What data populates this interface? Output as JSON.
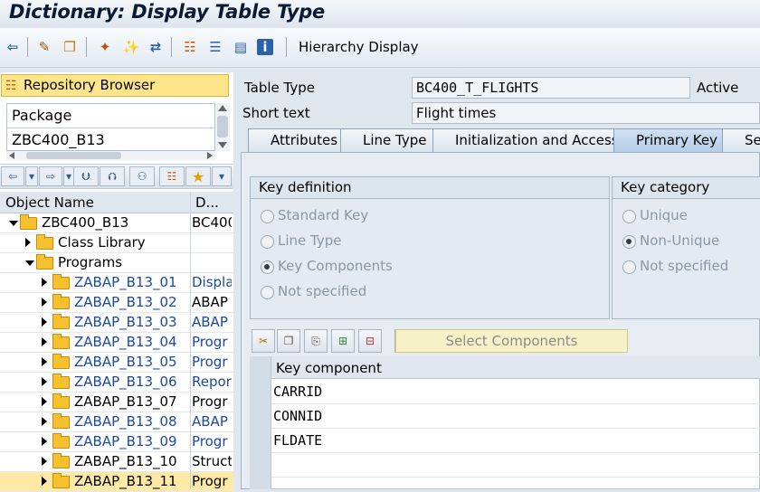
{
  "title": "Dictionary: Display Table Type",
  "toolbar": {
    "hierarchy_label": "Hierarchy Display"
  },
  "left": {
    "repo_button": "Repository Browser",
    "package_label": "Package",
    "package_value": "ZBC400_B13",
    "columns": {
      "name": "Object Name",
      "desc": "D..."
    },
    "tree": [
      {
        "name": "ZBC400_B13",
        "desc": "BC400",
        "level": 0,
        "expanded": true
      },
      {
        "name": "Class Library",
        "desc": "",
        "level": 1,
        "expanded": false
      },
      {
        "name": "Programs",
        "desc": "",
        "level": 1,
        "expanded": true
      },
      {
        "name": "ZABAP_B13_01",
        "desc": "Displa",
        "level": 2
      },
      {
        "name": "ZABAP_B13_02",
        "desc": "ABAP",
        "level": 2
      },
      {
        "name": "ZABAP_B13_03",
        "desc": "ABAP",
        "level": 2
      },
      {
        "name": "ZABAP_B13_04",
        "desc": "Progr",
        "level": 2
      },
      {
        "name": "ZABAP_B13_05",
        "desc": "Progr",
        "level": 2
      },
      {
        "name": "ZABAP_B13_06",
        "desc": "Repor",
        "level": 2
      },
      {
        "name": "ZABAP_B13_07",
        "desc": "Progr",
        "level": 2
      },
      {
        "name": "ZABAP_B13_08",
        "desc": "ABAP",
        "level": 2
      },
      {
        "name": "ZABAP_B13_09",
        "desc": "Progr",
        "level": 2
      },
      {
        "name": "ZABAP_B13_10",
        "desc": "Struct",
        "level": 2
      },
      {
        "name": "ZABAP_B13_11",
        "desc": "Progr",
        "level": 2
      }
    ]
  },
  "main": {
    "table_type_label": "Table Type",
    "table_type_value": "BC400_T_FLIGHTS",
    "status": "Active",
    "short_text_label": "Short text",
    "short_text_value": "Flight times",
    "tabs": [
      "Attributes",
      "Line Type",
      "Initialization and Access",
      "Primary Key",
      "Se"
    ],
    "key_definition": {
      "title": "Key definition",
      "options": [
        "Standard Key",
        "Line Type",
        "Key Components",
        "Not specified"
      ],
      "selected": "Key Components"
    },
    "key_category": {
      "title": "Key category",
      "options": [
        "Unique",
        "Non-Unique",
        "Not specified"
      ],
      "selected": "Non-Unique"
    },
    "select_components": "Select Components",
    "grid_header": "Key component",
    "key_components": [
      "CARRID",
      "CONNID",
      "FLDATE"
    ]
  }
}
